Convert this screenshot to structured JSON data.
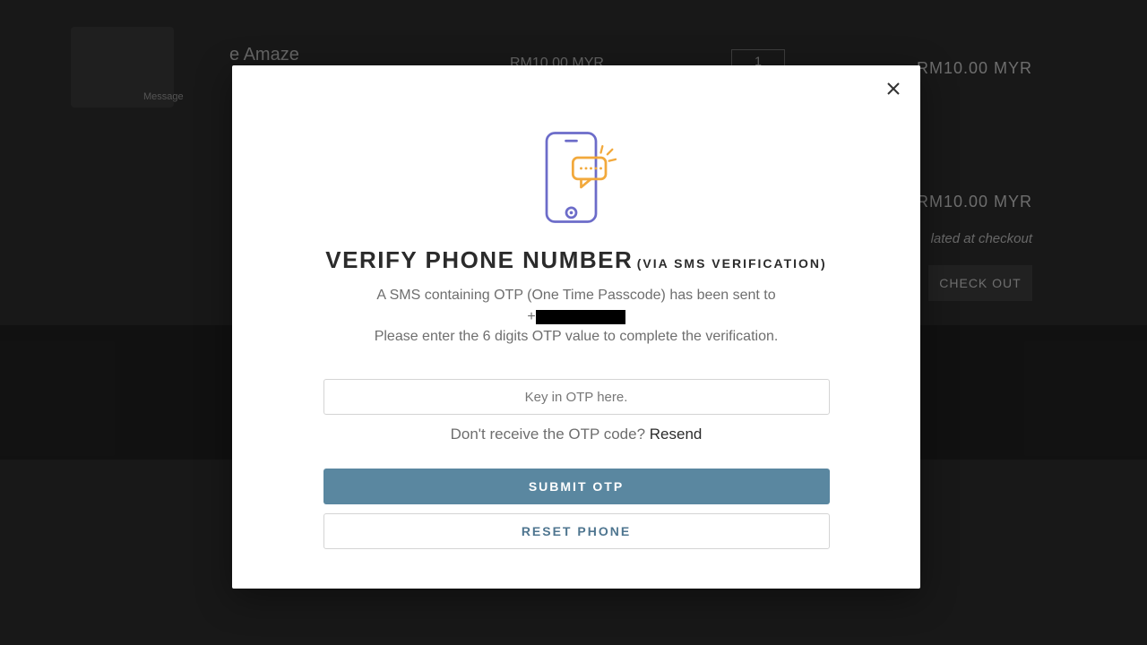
{
  "background": {
    "product_title": "e Amaze",
    "product_price": "RM10.00 MYR",
    "qty_value": "1",
    "line_price_1": "RM10.00 MYR",
    "line_price_2": "RM10.00 MYR",
    "checkout_note": "lated at checkout",
    "checkout_button": "CHECK OUT",
    "msg_label": "Message"
  },
  "modal": {
    "title_main": "VERIFY PHONE NUMBER",
    "title_sub": "(VIA SMS VERIFICATION)",
    "desc_line1": "A SMS containing OTP (One Time Passcode) has been sent to",
    "phone_prefix": "+",
    "desc_line2": "Please enter the 6 digits OTP value to complete the verification.",
    "otp_placeholder": "Key in OTP here.",
    "resend_prompt": "Don't receive the OTP code? ",
    "resend_link": "Resend",
    "submit_label": "SUBMIT OTP",
    "reset_label": "RESET PHONE"
  }
}
